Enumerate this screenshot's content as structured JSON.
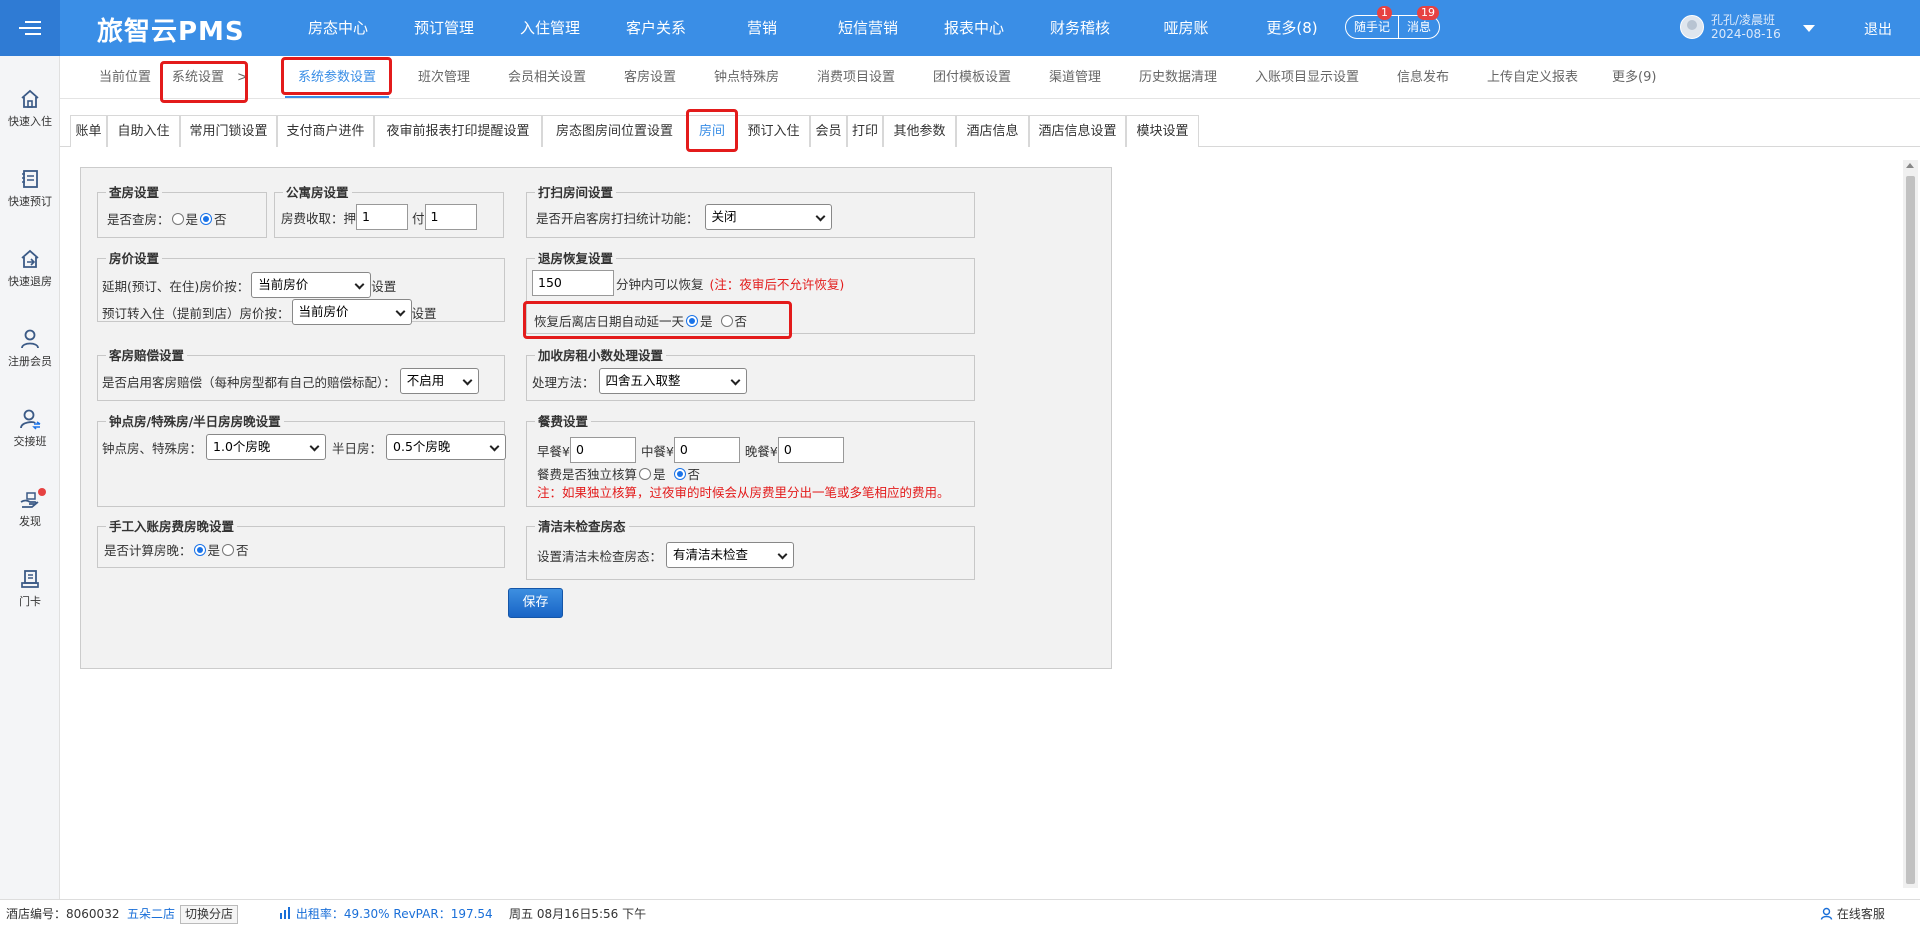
{
  "app": {
    "logo": "旅智云PMS"
  },
  "nav": [
    {
      "label": "房态中心"
    },
    {
      "label": "预订管理"
    },
    {
      "label": "入住管理"
    },
    {
      "label": "客户关系"
    },
    {
      "label": "营销"
    },
    {
      "label": "短信营销"
    },
    {
      "label": "报表中心"
    },
    {
      "label": "财务稽核"
    },
    {
      "label": "哑房账"
    },
    {
      "label": "更多(8)"
    }
  ],
  "header": {
    "memo_label": "随手记",
    "memo_badge": "1",
    "message_label": "消息",
    "message_badge": "19",
    "user_name": "孔孔/凌晨班",
    "user_date": "2024-08-16",
    "logout": "退出"
  },
  "sidebar": [
    {
      "label": "快速入住"
    },
    {
      "label": "快速预订"
    },
    {
      "label": "快速退房"
    },
    {
      "label": "注册会员"
    },
    {
      "label": "交接班"
    },
    {
      "label": "发现"
    },
    {
      "label": "门卡"
    }
  ],
  "breadcrumb": {
    "prefix": "当前位置",
    "item": "系统设置",
    "sep": ">"
  },
  "tabs1": [
    {
      "label": "系统参数设置"
    },
    {
      "label": "班次管理"
    },
    {
      "label": "会员相关设置"
    },
    {
      "label": "客房设置"
    },
    {
      "label": "钟点特殊房"
    },
    {
      "label": "消费项目设置"
    },
    {
      "label": "团付模板设置"
    },
    {
      "label": "渠道管理"
    },
    {
      "label": "历史数据清理"
    },
    {
      "label": "入账项目显示设置"
    },
    {
      "label": "信息发布"
    },
    {
      "label": "上传自定义报表"
    },
    {
      "label": "更多(9)"
    }
  ],
  "tabs2": [
    {
      "label": "账单"
    },
    {
      "label": "自助入住"
    },
    {
      "label": "常用门锁设置"
    },
    {
      "label": "支付商户进件"
    },
    {
      "label": "夜审前报表打印提醒设置"
    },
    {
      "label": "房态图房间位置设置"
    },
    {
      "label": "房间"
    },
    {
      "label": "预订入住"
    },
    {
      "label": "会员"
    },
    {
      "label": "打印"
    },
    {
      "label": "其他参数"
    },
    {
      "label": "酒店信息"
    },
    {
      "label": "酒店信息设置"
    },
    {
      "label": "模块设置"
    }
  ],
  "form": {
    "check_room": {
      "title": "查房设置",
      "label": "是否查房：",
      "yes": "是",
      "no": "否"
    },
    "apartment": {
      "title": "公寓房设置",
      "label": "房费收取：",
      "deposit_label": "押",
      "deposit": "1",
      "pay_label": "付",
      "pay": "1"
    },
    "cleaning": {
      "title": "打扫房间设置",
      "label": "是否开启客房打扫统计功能：",
      "value": "关闭"
    },
    "price": {
      "title": "房价设置",
      "label1": "延期(预订、在住)房价按：",
      "value1": "当前房价",
      "suffix1": "设置",
      "label2": "预订转入住（提前到店）房价按：",
      "value2": "当前房价",
      "suffix2": "设置"
    },
    "checkout_restore": {
      "title": "退房恢复设置",
      "minutes": "150",
      "text": "分钟内可以恢复",
      "note": "(注：夜审后不允许恢复)",
      "extend_label": "恢复后离店日期自动延一天",
      "yes": "是",
      "no": "否"
    },
    "compensation": {
      "title": "客房赔偿设置",
      "label": "是否启用客房赔偿（每种房型都有自己的赔偿标配）：",
      "value": "不启用"
    },
    "decimal": {
      "title": "加收房租小数处理设置",
      "label": "处理方法：",
      "value": "四舍五入取整"
    },
    "hourly": {
      "title": "钟点房/特殊房/半日房房晚设置",
      "label1": "钟点房、特殊房：",
      "value1": "1.0个房晚",
      "label2": "半日房：",
      "value2": "0.5个房晚"
    },
    "meal": {
      "title": "餐费设置",
      "breakfast_label": "早餐¥",
      "breakfast": "0",
      "lunch_label": "中餐¥",
      "lunch": "0",
      "dinner_label": "晚餐¥",
      "dinner": "0",
      "separate_label": "餐费是否独立核算",
      "yes": "是",
      "no": "否",
      "note": "注：如果独立核算，过夜审的时候会从房费里分出一笔或多笔相应的费用。"
    },
    "manual": {
      "title": "手工入账房费房晚设置",
      "label": "是否计算房晚：",
      "yes": "是",
      "no": "否"
    },
    "uninspected": {
      "title": "清洁未检查房态",
      "label": "设置清洁未检查房态：",
      "value": "有清洁未检查"
    },
    "save": "保存"
  },
  "status": {
    "hotel_label": "酒店编号：",
    "hotel_no": "8060032",
    "branch": "五朵二店",
    "switch": "切换分店",
    "occupancy": "出租率：49.30% RevPAR：197.54",
    "datetime": "周五 08月16日5:56 下午",
    "service": "在线客服"
  }
}
